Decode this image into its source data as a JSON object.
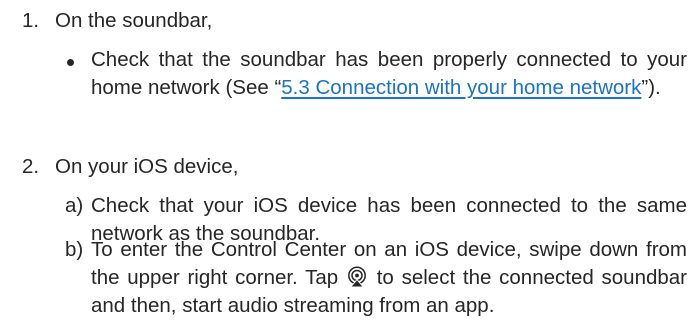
{
  "steps": [
    {
      "number": "1.",
      "label": "On the soundbar,",
      "items": [
        {
          "marker": "bullet",
          "text_before": "Check that the soundbar has been properly connected to your home network (See “",
          "link_text": "5.3 Connection with your home network",
          "text_after": "”)."
        }
      ]
    },
    {
      "number": "2.",
      "label": "On your iOS device,",
      "items": [
        {
          "marker": "a)",
          "text": "Check that your iOS device has been connected to the same network as the soundbar."
        },
        {
          "marker": "b)",
          "text_before": "To enter the Control Center on an iOS device, swipe down from the upper right corner. Tap ",
          "icon": "airplay-audio-icon",
          "text_after": " to select the connected soundbar and then, start audio streaming from an app."
        }
      ]
    }
  ],
  "colors": {
    "text": "#262626",
    "link": "#1a73c8"
  }
}
